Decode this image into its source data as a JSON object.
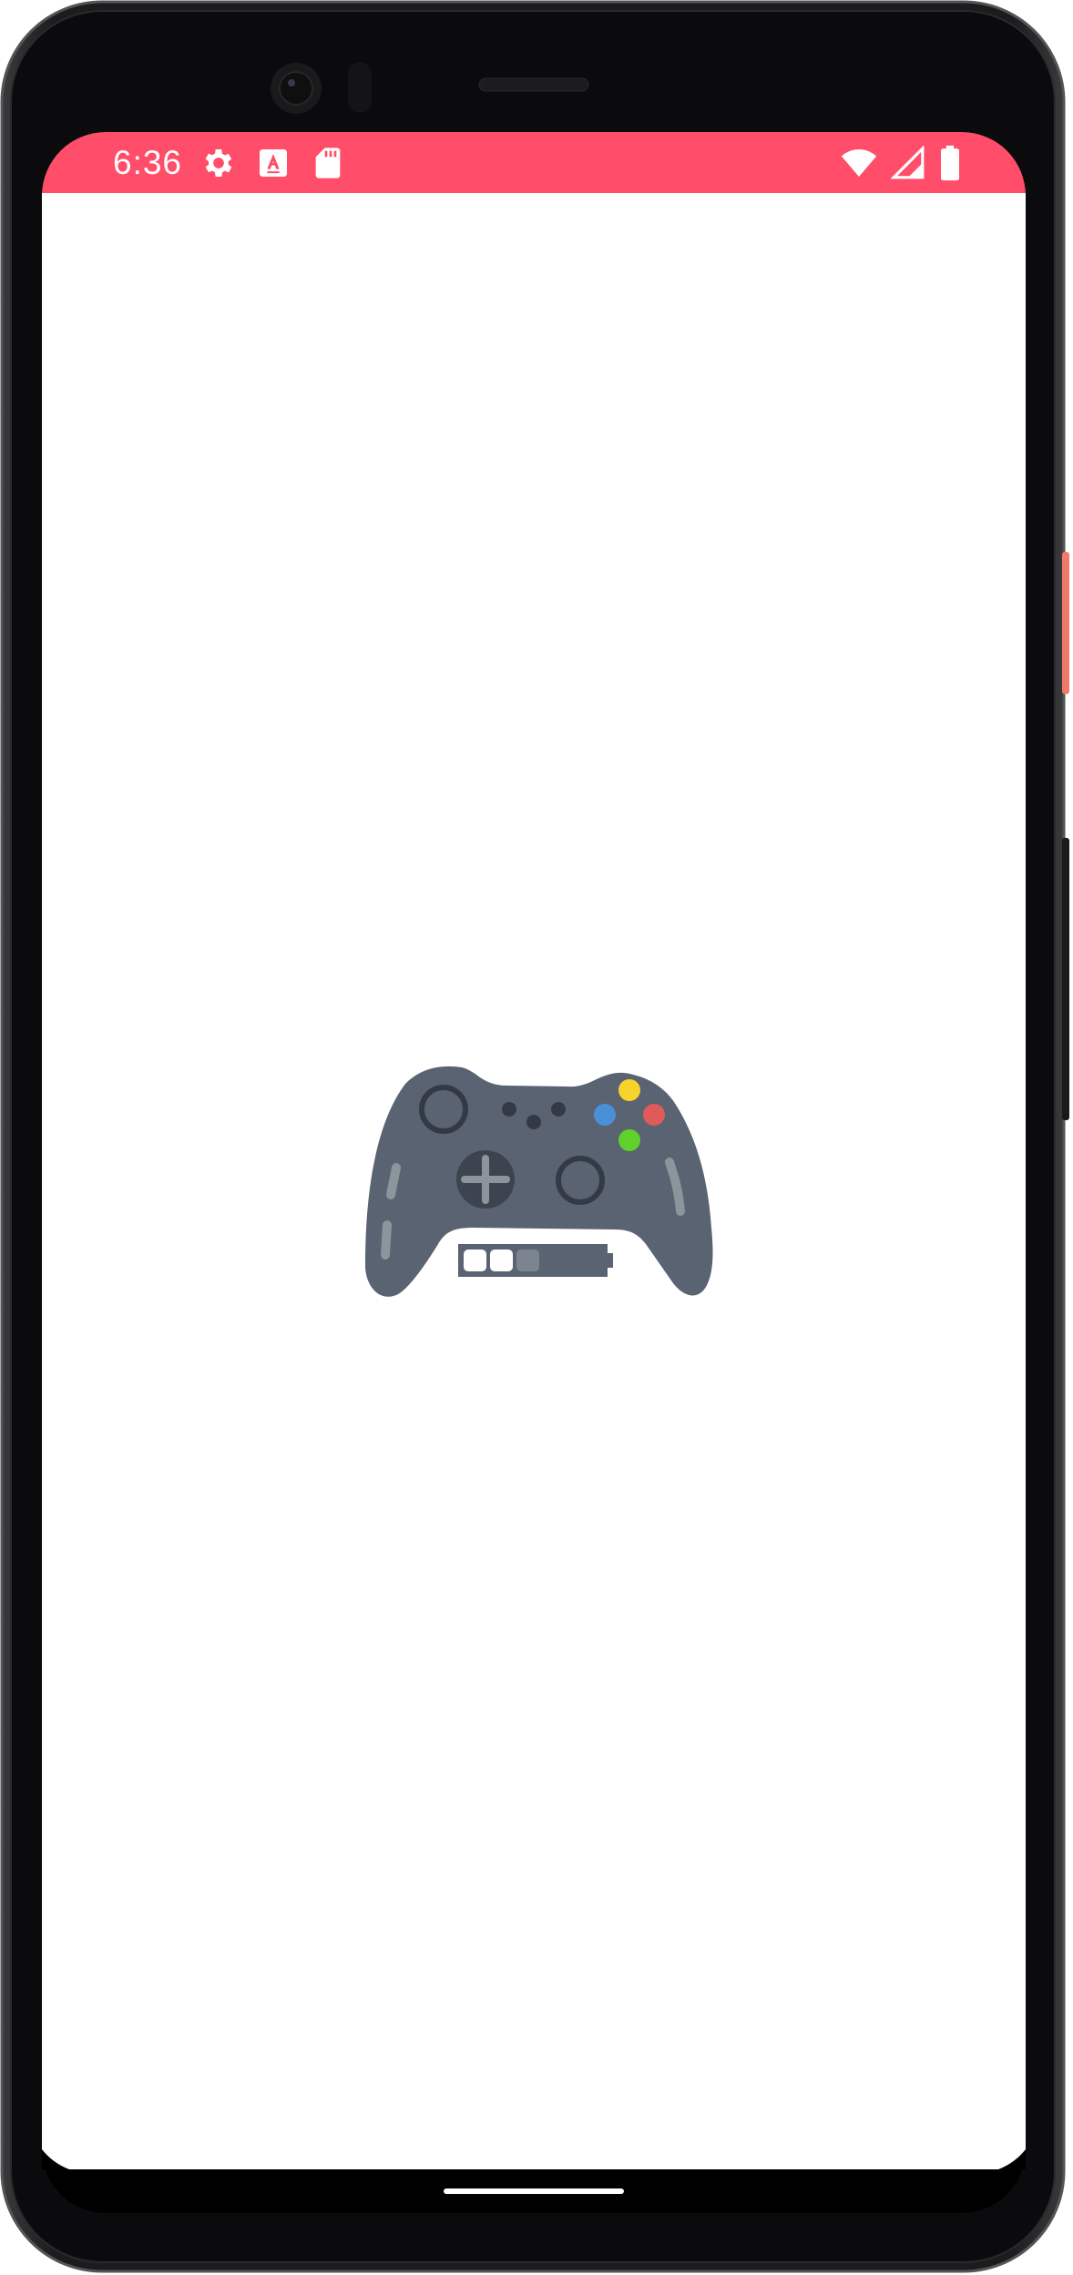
{
  "status_bar": {
    "time": "6:36",
    "background_color": "#ff4d6a",
    "left_icons": [
      "gear-icon",
      "text-a-icon",
      "sd-card-icon"
    ],
    "right_icons": [
      "wifi-icon",
      "signal-icon",
      "battery-icon"
    ]
  },
  "app": {
    "background_color": "#ffffff",
    "splash_icon": "game-controller-icon",
    "controller": {
      "body_color": "#5a6371",
      "button_colors": {
        "yellow": "#f7d32c",
        "blue": "#4a90d9",
        "red": "#e05a5a",
        "green": "#5ed12a"
      },
      "battery_level": "2 of 3"
    }
  },
  "navigation": {
    "home_handle": "gesture-handle"
  },
  "device": {
    "frame_color": "#0b0b0d",
    "accent_button_color": "#f07a6a"
  }
}
